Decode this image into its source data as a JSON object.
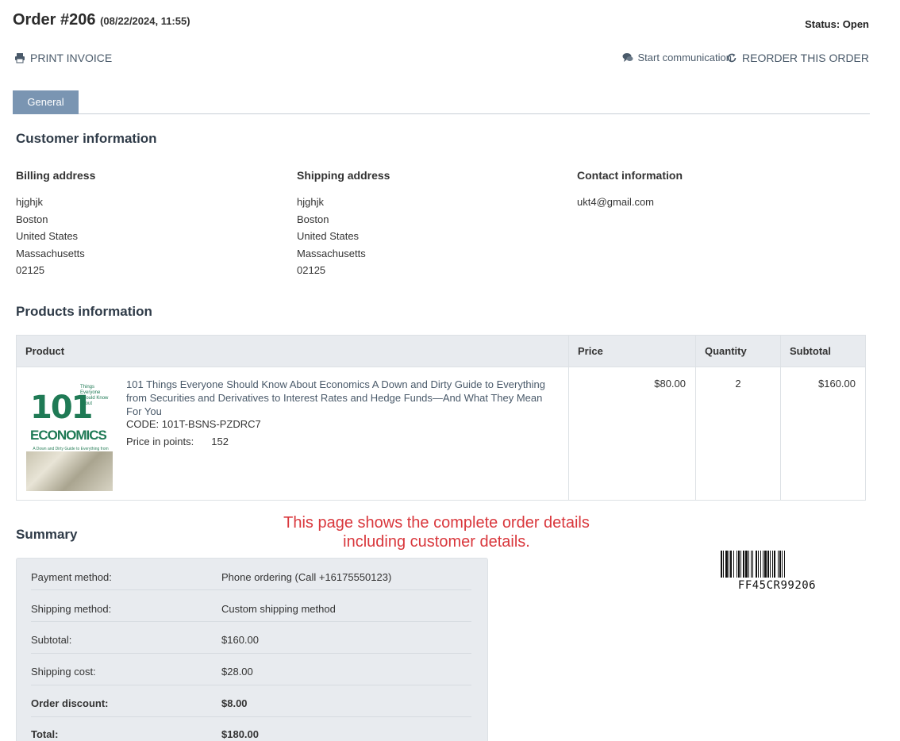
{
  "header": {
    "order_title": "Order #206",
    "order_date": "(08/22/2024, 11:55)",
    "status": "Status: Open"
  },
  "actions": {
    "print_invoice": "PRINT INVOICE",
    "start_communication": "Start communication",
    "reorder": "REORDER THIS ORDER"
  },
  "tabs": [
    {
      "label": "General"
    }
  ],
  "customer": {
    "section_title": "Customer information",
    "billing": {
      "title": "Billing address",
      "lines": [
        "hjghjk",
        "Boston",
        "United States",
        "Massachusetts",
        "02125"
      ]
    },
    "shipping": {
      "title": "Shipping address",
      "lines": [
        "hjghjk",
        "Boston",
        "United States",
        "Massachusetts",
        "02125"
      ]
    },
    "contact": {
      "title": "Contact information",
      "email": "ukt4@gmail.com"
    }
  },
  "products": {
    "section_title": "Products information",
    "columns": [
      "Product",
      "Price",
      "Quantity",
      "Subtotal"
    ],
    "items": [
      {
        "name": "101 Things Everyone Should Know About Economics A Down and Dirty Guide to Everything from Securities and Derivatives to Interest Rates and Hedge Funds—And What They Mean For You",
        "code": "CODE: 101T-BSNS-PZDRC7",
        "points_label": "Price in points:",
        "points_value": "152",
        "price": "$80.00",
        "quantity": "2",
        "subtotal": "$160.00",
        "cover": {
          "big": "101",
          "small": "Things Everyone Should Know about",
          "title": "ECONOMICS",
          "subtitle": "A Down and Dirty Guide to Everything from Securities and Derivatives to Interest Rates and Hedge Funds—And What They Mean for You"
        }
      }
    ]
  },
  "note": "This page shows the complete order details including customer details.",
  "summary": {
    "section_title": "Summary",
    "rows": [
      {
        "label": "Payment method:",
        "value": "Phone ordering (Call +16175550123)"
      },
      {
        "label": "Shipping method:",
        "value": "Custom shipping method"
      },
      {
        "label": "Subtotal:",
        "value": "$160.00"
      },
      {
        "label": "Shipping cost:",
        "value": "$28.00"
      },
      {
        "label": "Order discount:",
        "value": "$8.00"
      },
      {
        "label": "Total:",
        "value": "$180.00"
      }
    ]
  },
  "barcode": {
    "text": "FF45CR99206"
  },
  "colors": {
    "tab_active": "#7a95b2",
    "note": "#d9373c",
    "summary_bg": "#e8ebef"
  }
}
